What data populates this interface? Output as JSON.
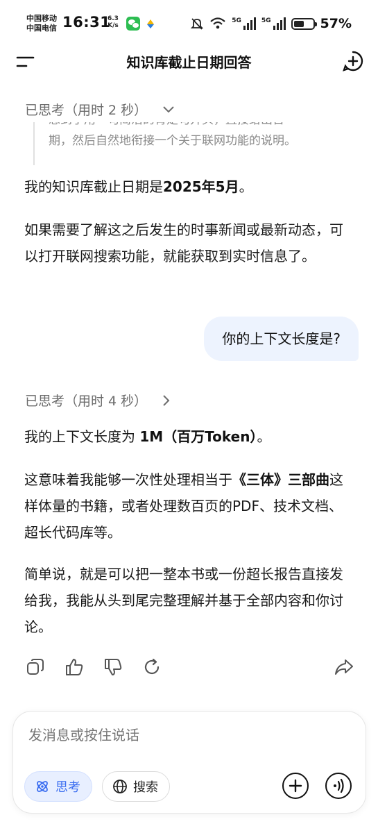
{
  "status_bar": {
    "carrier_1": "中国移动",
    "carrier_2": "中国电信",
    "time": "16:31",
    "net_speed_value": "6.3",
    "net_speed_unit": "K/s",
    "network_1": "5G",
    "network_2": "5G",
    "battery_percent": "57%",
    "battery_level": 0.57,
    "icons": [
      "wechat-icon",
      "app-icon",
      "mute-icon",
      "wifi-icon",
      "signal-icon",
      "battery-icon"
    ]
  },
  "header": {
    "title": "知识库截止日期回答",
    "icons": [
      "menu-icon",
      "new-chat-icon"
    ]
  },
  "conversation": {
    "thought_1": {
      "label": "已思考（用时 2 秒）",
      "excerpt_line_1": "想到了用一句简洁的肯定句开头，直接给出日",
      "excerpt_line_2": "期，然后自然地衔接一个关于联网功能的说明。"
    },
    "answer_1": {
      "p1_prefix": "我的知识库截止日期是",
      "p1_bold": "2025年5月",
      "p1_suffix": "。",
      "p2": "如果需要了解这之后发生的时事新闻或最新动态，可以打开联网搜索功能，就能获取到实时信息了。"
    },
    "user_message": "你的上下文长度是?",
    "thought_2": {
      "label": "已思考（用时 4 秒）"
    },
    "answer_2": {
      "p1_prefix": "我的上下文长度为 ",
      "p1_bold": "1M（百万Token）",
      "p1_suffix": "。",
      "p2_prefix": "这意味着我能够一次性处理相当于",
      "p2_bold": "《三体》三部曲",
      "p2_suffix": "这样体量的书籍，或者处理数百页的PDF、技术文档、超长代码库等。",
      "p3": "简单说，就是可以把一整本书或一份超长报告直接发给我，我能从头到尾完整理解并基于全部内容和你讨论。"
    }
  },
  "message_actions": [
    "copy-icon",
    "thumbs-up-icon",
    "thumbs-down-icon",
    "regenerate-icon",
    "share-icon"
  ],
  "composer": {
    "placeholder": "发消息或按住说话",
    "think_label": "思考",
    "search_label": "搜索"
  },
  "colors": {
    "accent": "#3a6df0",
    "user_bubble": "#edf3fe",
    "muted_text": "#6b6b6b"
  }
}
